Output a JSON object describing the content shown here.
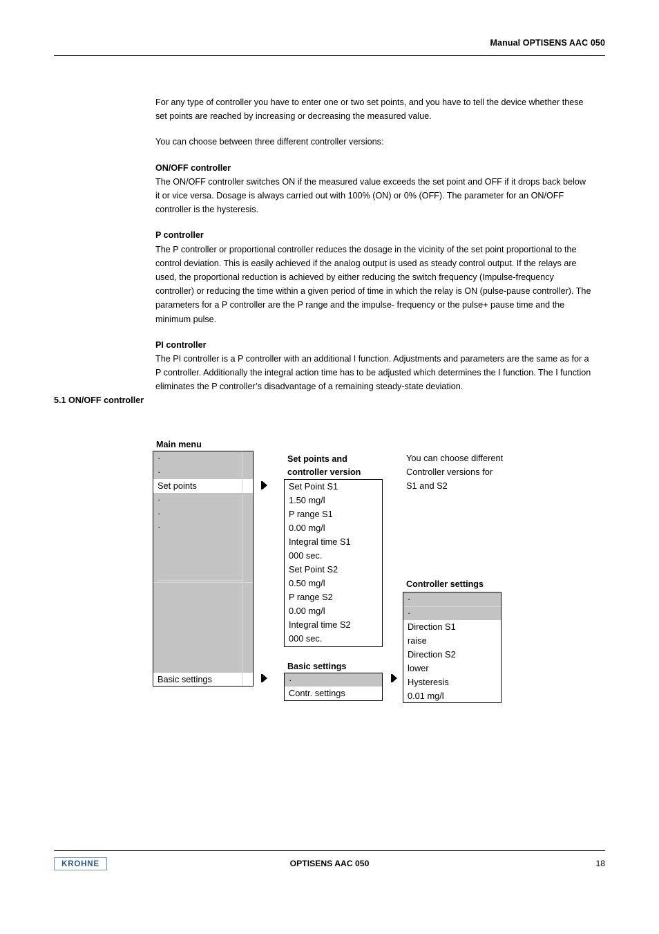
{
  "header": {
    "title": "Manual OPTISENS AAC 050"
  },
  "body": {
    "intro_paragraph": "For any type of controller you have to enter one or two set points, and you have to tell the device whether these set points are reached by increasing or decreasing the measured value.",
    "choose_paragraph": "You can choose between three different controller versions:",
    "sections": [
      {
        "heading": "ON/OFF controller",
        "text": "The ON/OFF controller switches ON if the measured value exceeds the set point and OFF if it drops back below it or vice versa. Dosage is always carried out with 100% (ON) or 0% (OFF). The parameter for an ON/OFF controller is the hysteresis."
      },
      {
        "heading": "P controller",
        "text": "The P controller or proportional controller reduces the dosage in the vicinity of the set point proportional to the control deviation. This is easily achieved if the analog output is used as steady control output. If the relays are used, the proportional reduction is achieved by either reducing the switch frequency (Impulse-frequency controller) or reducing the time within a given period of time in which the relay is ON (pulse-pause controller). The parameters for a P controller are the P range and the impulse- frequency or the pulse+ pause time and the minimum pulse."
      },
      {
        "heading": "PI controller",
        "text": "The PI controller is a P controller with an additional I function. Adjustments and parameters are the same as for a P controller. Additionally the integral action time has to be adjusted which determines the I function. The I function eliminates the P controller’s disadvantage of a remaining steady-state deviation."
      }
    ],
    "section_heading": "5.1 ON/OFF controller"
  },
  "diagram": {
    "main_menu": {
      "label": "Main menu",
      "rows": [
        {
          "text": "",
          "style": "gray",
          "dot": true
        },
        {
          "text": "",
          "style": "gray",
          "dot": true
        },
        {
          "text": "Set points",
          "style": "white",
          "dot": false
        },
        {
          "text": "",
          "style": "gray",
          "dot": true
        },
        {
          "text": "",
          "style": "gray",
          "dot": true
        },
        {
          "text": "",
          "style": "gray",
          "dot": true
        },
        {
          "text": "",
          "style": "gray",
          "dot": false
        },
        {
          "text": "",
          "style": "gray",
          "dot": false
        },
        {
          "text": "",
          "style": "gray",
          "dot": false
        },
        {
          "text": "",
          "style": "gray",
          "dot": false
        },
        {
          "text": "",
          "style": "gray",
          "dot": false
        },
        {
          "text": "",
          "style": "gray",
          "dot": false
        },
        {
          "text": "",
          "style": "gray",
          "dot": false
        },
        {
          "text": "",
          "style": "gray",
          "dot": false
        },
        {
          "text": "",
          "style": "gray",
          "dot": false
        },
        {
          "text": "",
          "style": "gray",
          "dot": false
        },
        {
          "text": "Basic settings",
          "style": "white",
          "dot": false
        }
      ]
    },
    "set_points": {
      "label_line1": "Set points and",
      "label_line2": "controller version",
      "rows": [
        "Set Point S1",
        "1.50 mg/l",
        "P range S1",
        "0.00 mg/l",
        "Integral time S1",
        "000 sec.",
        "Set Point S2",
        "0.50 mg/l",
        "P range S2",
        "0.00 mg/l",
        "Integral time S2",
        "000 sec."
      ]
    },
    "note": {
      "line1": "You can choose different",
      "line2": "Controller versions for",
      "line3": "S1 and S2"
    },
    "controller_settings": {
      "label": "Controller settings",
      "rows": [
        {
          "text": "",
          "style": "gray",
          "dot": true
        },
        {
          "text": "",
          "style": "gray",
          "dot": true
        },
        {
          "text": "Direction S1",
          "style": "white",
          "dot": false
        },
        {
          "text": "raise",
          "style": "white",
          "dot": false
        },
        {
          "text": "Direction S2",
          "style": "white",
          "dot": false
        },
        {
          "text": "lower",
          "style": "white",
          "dot": false
        },
        {
          "text": "Hysteresis",
          "style": "white",
          "dot": false
        },
        {
          "text": "0.01 mg/l",
          "style": "white",
          "dot": false
        }
      ]
    },
    "basic_settings": {
      "label": "Basic settings",
      "rows": [
        {
          "text": "",
          "style": "gray",
          "dot": true
        },
        {
          "text": "Contr. settings",
          "style": "white",
          "dot": false
        }
      ]
    }
  },
  "footer": {
    "logo_text": "KROHNE",
    "center_text": "OPTISENS AAC 050",
    "page_number": "18"
  },
  "colors": {
    "lcd_gray": "#c3c3c3",
    "logo_blue": "#2a5699",
    "logo_border": "#6f93c8"
  }
}
